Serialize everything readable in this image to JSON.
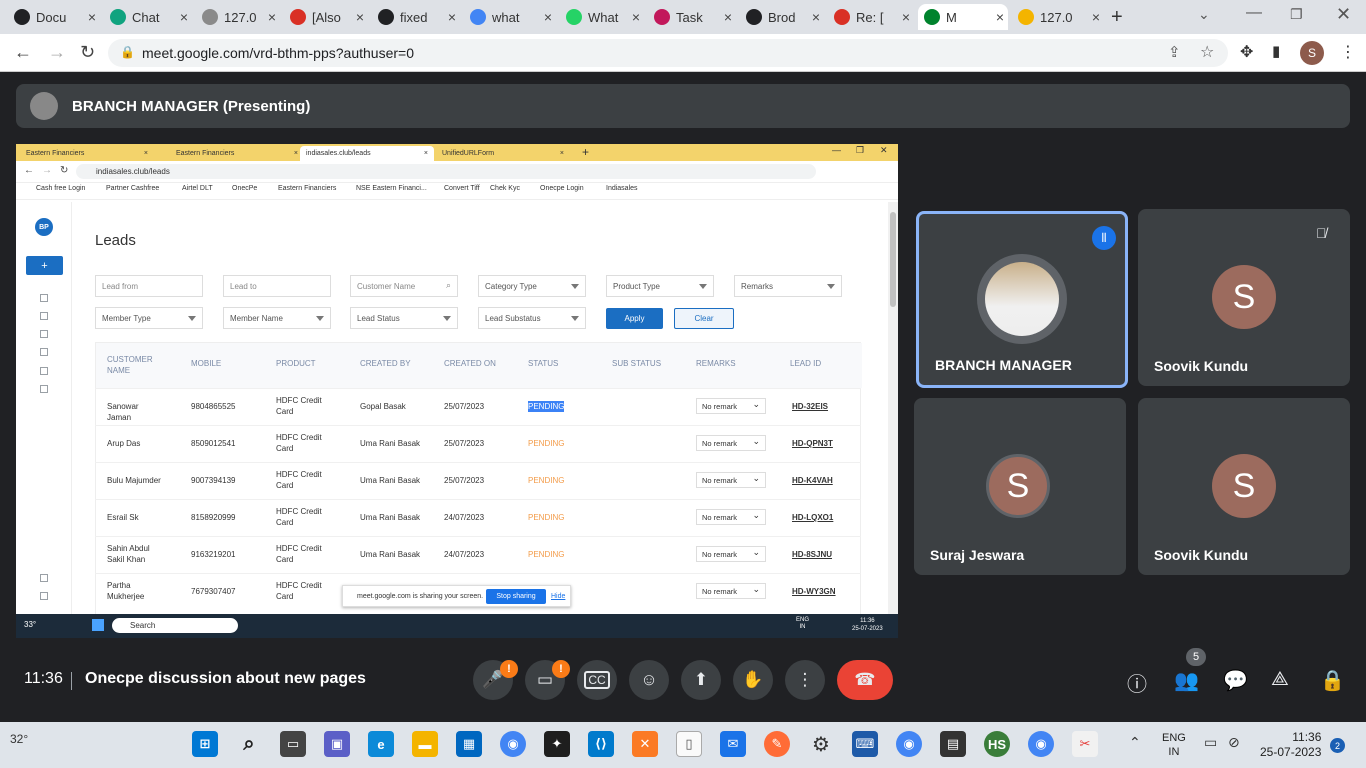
{
  "browser": {
    "tabs": [
      {
        "label": "Docu",
        "color": "#202124"
      },
      {
        "label": "Chat",
        "color": "#10a37f"
      },
      {
        "label": "127.0",
        "color": "#8a8a8a"
      },
      {
        "label": "[Also",
        "color": "#d93025"
      },
      {
        "label": "fixed",
        "color": "#202124"
      },
      {
        "label": "what",
        "color": "#4285f4"
      },
      {
        "label": "What",
        "color": "#25d366"
      },
      {
        "label": "Task",
        "color": "#c2185b"
      },
      {
        "label": "Brod",
        "color": "#202124"
      },
      {
        "label": "Re: [",
        "color": "#d93025"
      },
      {
        "label": "M",
        "color": "#00832d"
      },
      {
        "label": "127.0",
        "color": "#f4b400"
      }
    ],
    "url": "meet.google.com/vrd-bthm-pps?authuser=0",
    "profile_initial": "S"
  },
  "presenter_bar": {
    "title": "BRANCH MANAGER (Presenting)"
  },
  "shared_screen": {
    "tabs": [
      "Eastern Financiers",
      "Eastern Financiers",
      "indiasales.club/leads",
      "UnifiedURLForm"
    ],
    "url": "indiasales.club/leads",
    "bookmarks": [
      "Cash free Login",
      "Partner Cashfree",
      "Airtel DLT",
      "OnecPe",
      "Eastern Financiers",
      "NSE Eastern Financi...",
      "Convert Tiff",
      "Chek Kyc",
      "Onecpe Login",
      "Indiasales"
    ],
    "sidebar_badge": "BP",
    "add_button": "+",
    "page_title": "Leads",
    "filters": {
      "lead_from": "Lead from",
      "lead_to": "Lead to",
      "customer_name": "Customer Name",
      "category_type": "Category Type",
      "product_type": "Product Type",
      "remarks": "Remarks",
      "member_type": "Member Type",
      "member_name": "Member Name",
      "lead_status": "Lead Status",
      "lead_substatus": "Lead Substatus",
      "apply": "Apply",
      "clear": "Clear"
    },
    "table": {
      "headers": [
        "CUSTOMER NAME",
        "MOBILE",
        "PRODUCT",
        "CREATED BY",
        "CREATED ON",
        "STATUS",
        "SUB STATUS",
        "REMARKS",
        "LEAD ID"
      ],
      "rows": [
        {
          "name": "Sanowar Jaman",
          "mobile": "9804865525",
          "product": "HDFC Credit Card",
          "created_by": "Gopal Basak",
          "created_on": "25/07/2023",
          "status": "PENDING",
          "remarks": "No remark",
          "lead_id": "HD-32EIS"
        },
        {
          "name": "Arup Das",
          "mobile": "8509012541",
          "product": "HDFC Credit Card",
          "created_by": "Uma Rani Basak",
          "created_on": "25/07/2023",
          "status": "PENDING",
          "remarks": "No remark",
          "lead_id": "HD-QPN3T"
        },
        {
          "name": "Bulu Majumder",
          "mobile": "9007394139",
          "product": "HDFC Credit Card",
          "created_by": "Uma Rani Basak",
          "created_on": "25/07/2023",
          "status": "PENDING",
          "remarks": "No remark",
          "lead_id": "HD-K4VAH"
        },
        {
          "name": "Esrail Sk",
          "mobile": "8158920999",
          "product": "HDFC Credit Card",
          "created_by": "Uma Rani Basak",
          "created_on": "24/07/2023",
          "status": "PENDING",
          "remarks": "No remark",
          "lead_id": "HD-LQXO1"
        },
        {
          "name": "Sahin Abdul Sakil Khan",
          "mobile": "9163219201",
          "product": "HDFC Credit Card",
          "created_by": "Uma Rani Basak",
          "created_on": "24/07/2023",
          "status": "PENDING",
          "remarks": "No remark",
          "lead_id": "HD-8SJNU"
        },
        {
          "name": "Partha Mukherjee",
          "mobile": "7679307407",
          "product": "HDFC Credit Card",
          "created_by": "",
          "created_on": "",
          "status": "",
          "remarks": "No remark",
          "lead_id": "HD-WY3GN"
        }
      ]
    },
    "share_notice": {
      "text": "meet.google.com is sharing your screen.",
      "stop": "Stop sharing",
      "hide": "Hide"
    },
    "taskbar": {
      "temp": "33°",
      "search": "Search",
      "lang1": "ENG",
      "lang2": "IN",
      "time": "11:36",
      "date": "25-07-2023"
    }
  },
  "participants": [
    {
      "name": "BRANCH MANAGER",
      "initial": "",
      "active": true
    },
    {
      "name": "Soovik Kundu",
      "initial": "S",
      "muted": true
    },
    {
      "name": "Suraj Jeswara",
      "initial": "S"
    },
    {
      "name": "Soovik Kundu",
      "initial": "S"
    }
  ],
  "meeting": {
    "time": "11:36",
    "title": "Onecpe discussion about new pages",
    "people_count": "5",
    "mic_badge": "!",
    "cam_badge": "!"
  },
  "os_taskbar": {
    "temp": "32°",
    "lang1": "ENG",
    "lang2": "IN",
    "time": "11:36",
    "date": "25-07-2023",
    "notifications": "2"
  },
  "colors": {
    "meet_bg": "#202124",
    "accent": "#1a73e8",
    "end_call": "#ea4335",
    "pending": "#f39c4a"
  }
}
